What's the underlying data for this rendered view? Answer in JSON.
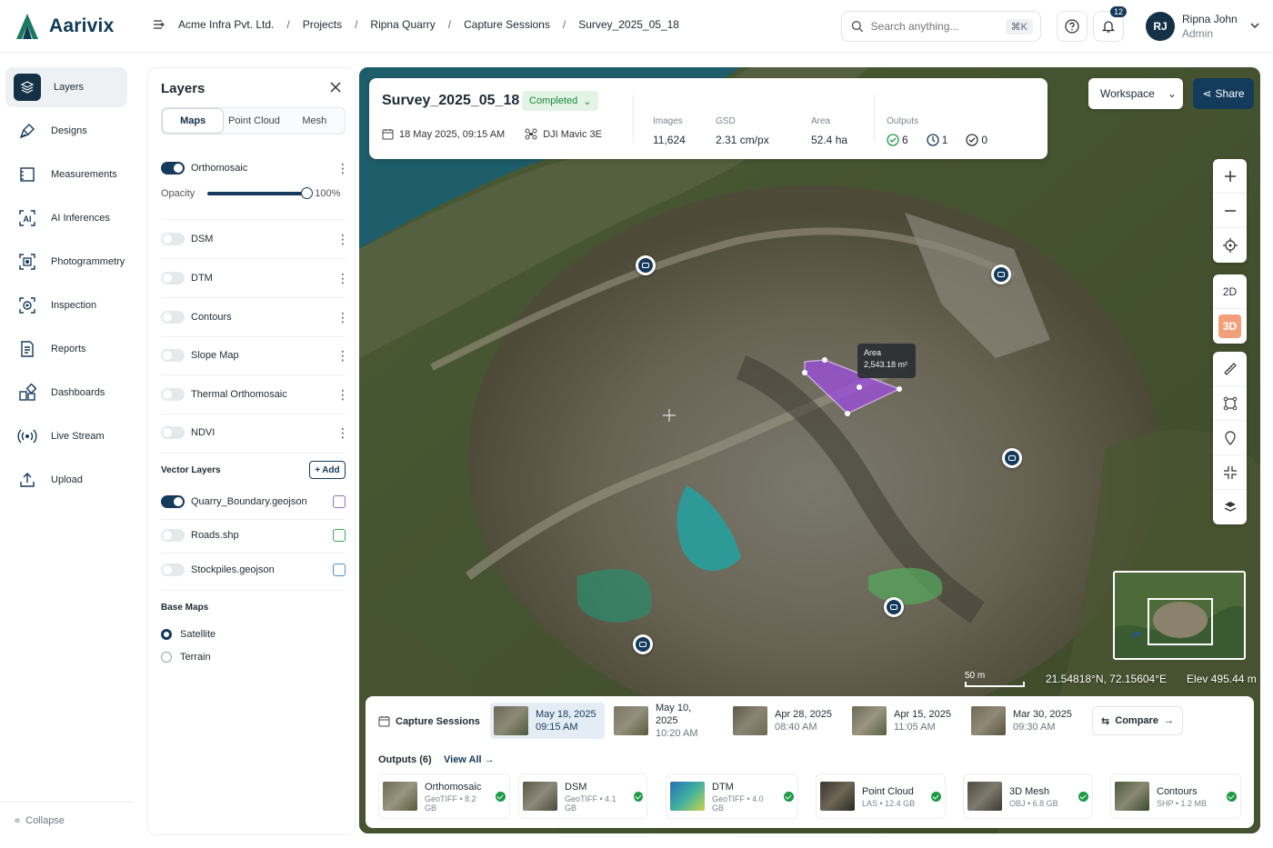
{
  "app": {
    "name": "Aarivix"
  },
  "breadcrumb": [
    "Acme Infra Pvt. Ltd.",
    "Projects",
    "Ripna Quarry",
    "Capture Sessions",
    "Survey_2025_05_18"
  ],
  "search": {
    "placeholder": "Search anything...",
    "shortcut": "⌘K"
  },
  "notifications": {
    "count": "12"
  },
  "user": {
    "initials": "RJ",
    "name": "Ripna John",
    "role": "Admin"
  },
  "sidebar": {
    "items": [
      {
        "label": "Layers",
        "icon": "layers-icon",
        "active": true
      },
      {
        "label": "Designs",
        "icon": "pen-tool-icon"
      },
      {
        "label": "Measurements",
        "icon": "ruler-icon"
      },
      {
        "label": "AI Inferences",
        "icon": "ai-scan-icon"
      },
      {
        "label": "Photogrammetry",
        "icon": "photogrammetry-icon"
      },
      {
        "label": "Inspection",
        "icon": "inspection-icon"
      },
      {
        "label": "Reports",
        "icon": "report-icon"
      },
      {
        "label": "Dashboards",
        "icon": "dashboard-icon"
      },
      {
        "label": "Live Stream",
        "icon": "live-stream-icon"
      },
      {
        "label": "Upload",
        "icon": "upload-icon"
      }
    ],
    "collapse_label": "Collapse"
  },
  "layers_panel": {
    "title": "Layers",
    "tabs": [
      "Maps",
      "Point Cloud",
      "Mesh"
    ],
    "active_tab": "Maps",
    "layers": [
      {
        "name": "Orthomosaic",
        "on": true
      },
      {
        "name": "DSM",
        "on": false
      },
      {
        "name": "DTM",
        "on": false
      },
      {
        "name": "Contours",
        "on": false
      },
      {
        "name": "Slope Map",
        "on": false
      },
      {
        "name": "Thermal Orthomosaic",
        "on": false
      },
      {
        "name": "NDVI",
        "on": false
      }
    ],
    "opacity_label": "Opacity",
    "opacity_value": "100%",
    "opacity_fraction": 1.0,
    "vector_title": "Vector Layers",
    "add_label": "Add",
    "vector_layers": [
      {
        "name": "Quarry_Boundary.geojson",
        "on": true,
        "color": "#8b6fc0"
      },
      {
        "name": "Roads.shp",
        "on": false,
        "color": "#3aaa5c"
      },
      {
        "name": "Stockpiles.geojson",
        "on": false,
        "color": "#4a90d9"
      }
    ],
    "basemaps_title": "Base Maps",
    "basemaps": [
      {
        "name": "Satellite",
        "selected": true
      },
      {
        "name": "Terrain",
        "selected": false
      }
    ]
  },
  "survey": {
    "title": "Survey_2025_05_18",
    "status": "Completed",
    "datetime": "18 May 2025, 09:15 AM",
    "drone": "DJI Mavic 3E",
    "images_label": "Images",
    "images": "11,624",
    "gsd_label": "GSD",
    "gsd": "2.31 cm/px",
    "area_label": "Area",
    "area": "52.4 ha",
    "outputs_label": "Outputs",
    "outputs_done": "6",
    "outputs_processing": "1",
    "outputs_failed": "0"
  },
  "map": {
    "workspace_label": "Workspace",
    "share_label": "Share",
    "tool_2d": "2D",
    "tool_3d": "3D",
    "tooltip_title": "Area",
    "tooltip_value": "2,543.18 m²",
    "scale_label": "50 m",
    "coords": "21.54818°N, 72.15604°E",
    "elevation": "Elev 495.44 m"
  },
  "capture_sessions": {
    "title": "Capture Sessions",
    "sessions": [
      {
        "date": "May 18, 2025",
        "time": "09:15 AM",
        "active": true
      },
      {
        "date": "May 10, 2025",
        "time": "10:20 AM"
      },
      {
        "date": "Apr 28, 2025",
        "time": "08:40 AM"
      },
      {
        "date": "Apr 15, 2025",
        "time": "11:05 AM"
      },
      {
        "date": "Mar 30, 2025",
        "time": "09:30 AM"
      }
    ],
    "compare_label": "Compare"
  },
  "outputs": {
    "label": "Outputs (6)",
    "view_all": "View All",
    "items": [
      {
        "name": "Orthomosaic",
        "meta": "GeoTIFF • 8.2 GB"
      },
      {
        "name": "DSM",
        "meta": "GeoTIFF • 4.1 GB"
      },
      {
        "name": "DTM",
        "meta": "GeoTIFF • 4.0 GB"
      },
      {
        "name": "Point Cloud",
        "meta": "LAS • 12.4 GB"
      },
      {
        "name": "3D Mesh",
        "meta": "OBJ • 6.8 GB"
      },
      {
        "name": "Contours",
        "meta": "SHP • 1.2 MB"
      }
    ]
  }
}
